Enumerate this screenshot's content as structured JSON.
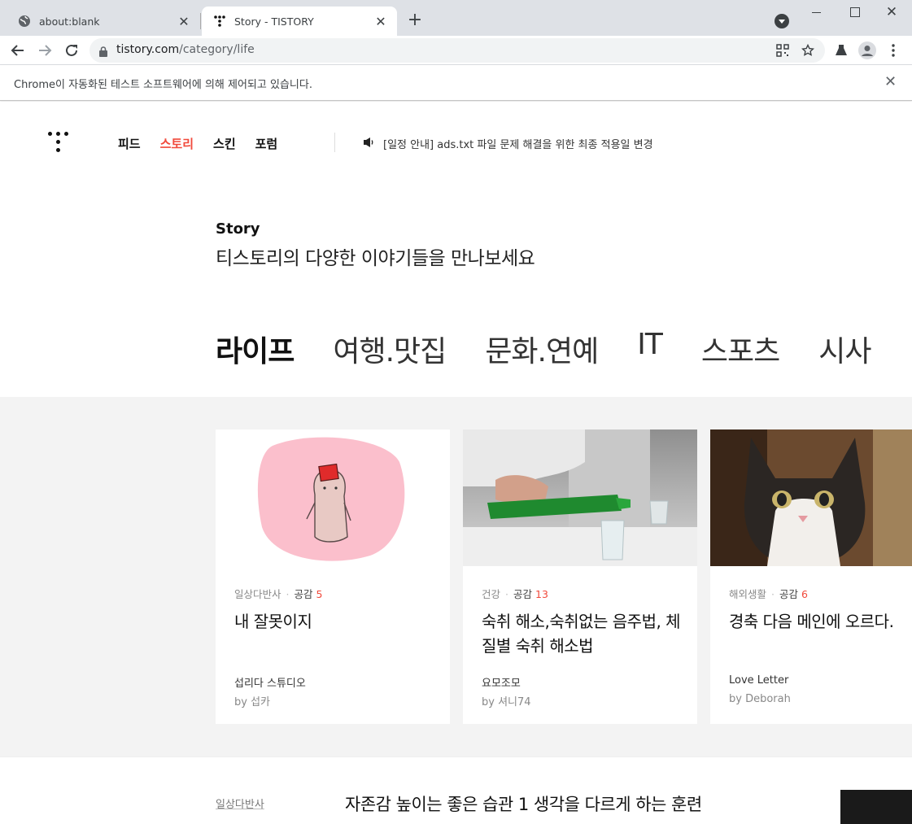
{
  "browser": {
    "tabs": [
      {
        "title": "about:blank",
        "icon": "globe-icon"
      },
      {
        "title": "Story - TISTORY",
        "icon": "tistory-favicon"
      }
    ],
    "url_host": "tistory.com",
    "url_path": "/category/life",
    "infobar_message": "Chrome이 자동화된 테스트 소프트웨어에 의해 제어되고 있습니다."
  },
  "header": {
    "nav": [
      {
        "label": "피드",
        "active": false
      },
      {
        "label": "스토리",
        "active": true
      },
      {
        "label": "스킨",
        "active": false
      },
      {
        "label": "포럼",
        "active": false
      }
    ],
    "notice": "[일정 안내] ads.txt 파일 문제 해결을 위한 최종 적용일 변경"
  },
  "story": {
    "label": "Story",
    "subtitle": "티스토리의 다양한 이야기들을 만나보세요"
  },
  "categories": [
    {
      "label": "라이프",
      "active": true
    },
    {
      "label": "여행.맛집",
      "active": false
    },
    {
      "label": "문화.연예",
      "active": false
    },
    {
      "label": "IT",
      "active": false
    },
    {
      "label": "스포츠",
      "active": false
    },
    {
      "label": "시사",
      "active": false
    }
  ],
  "cards": [
    {
      "category": "일상다반사",
      "likes_label": "공감",
      "likes": "5",
      "title": "내 잘못이지",
      "blog": "섭리다 스튜디오",
      "author": "by 섭카",
      "thumb": "pink-character-illustration"
    },
    {
      "category": "건강",
      "likes_label": "공감",
      "likes": "13",
      "title": "숙취 해소,숙취없는 음주법, 체질별 숙취 해소법",
      "blog": "요모조모",
      "author": "by 셔니74",
      "thumb": "soju-pouring-photo"
    },
    {
      "category": "해외생활",
      "likes_label": "공감",
      "likes": "6",
      "title": "경축 다음 메인에 오르다.",
      "blog": "Love Letter",
      "author": "by Deborah",
      "thumb": "cat-photo"
    }
  ],
  "list": [
    {
      "category": "일상다반사",
      "title": "자존감 높이는 좋은 습관 1 생각을 다르게 하는 훈련"
    }
  ],
  "colors": {
    "accent": "#f14a3c",
    "section_bg": "#f3f3f3"
  }
}
